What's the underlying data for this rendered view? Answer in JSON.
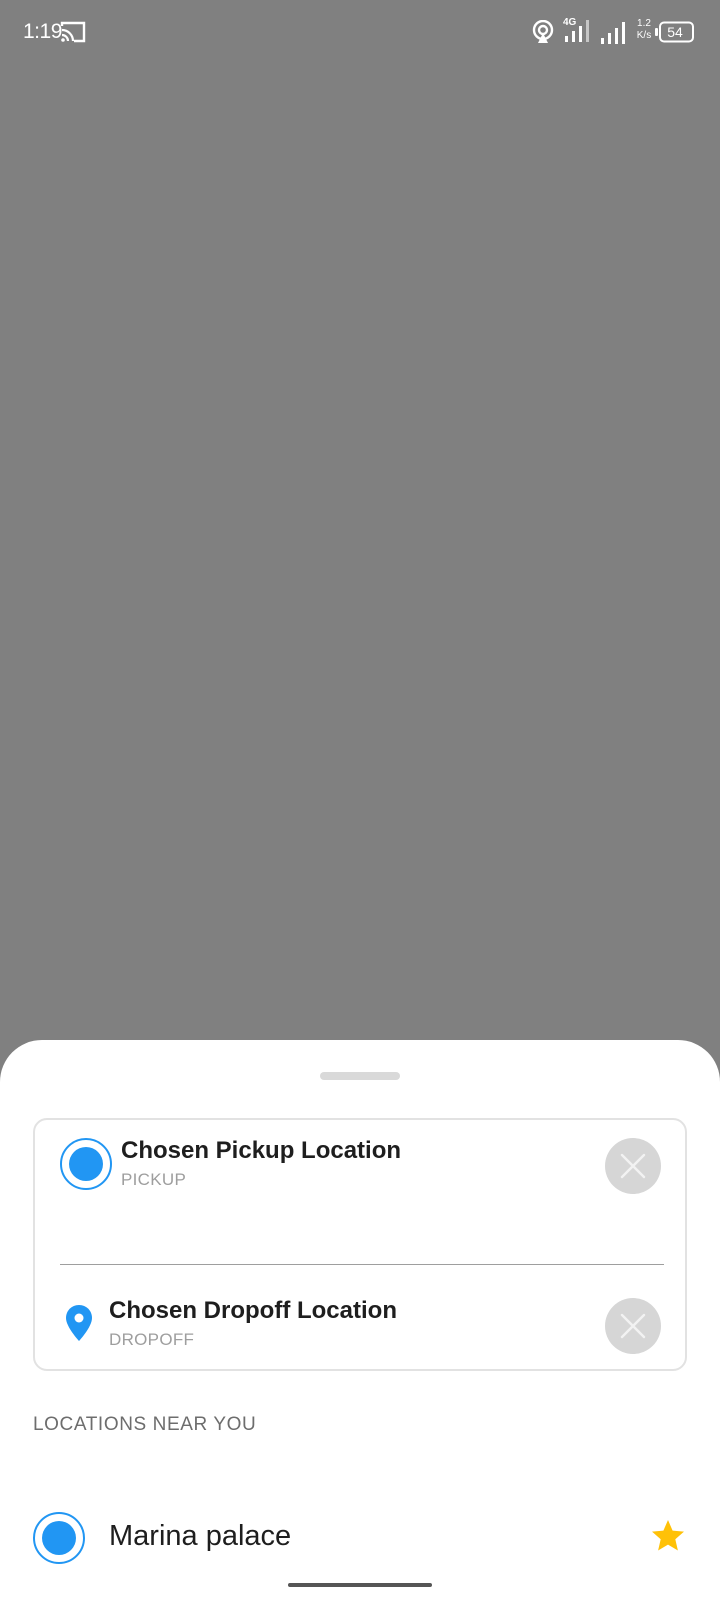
{
  "status_bar": {
    "time": "1:19",
    "network_type": "4G",
    "net_speed_value": "1.2",
    "net_speed_unit": "K/s",
    "battery": "54",
    "icons": [
      "cast-icon",
      "hotspot-icon",
      "signal-icon",
      "battery-icon"
    ]
  },
  "route": {
    "pickup": {
      "title": "Chosen Pickup Location",
      "subtitle": "PICKUP"
    },
    "dropoff": {
      "title": "Chosen Dropoff Location",
      "subtitle": "DROPOFF"
    }
  },
  "nearby": {
    "heading": "LOCATIONS NEAR YOU",
    "items": [
      {
        "name": "Marina palace",
        "favorite": true
      }
    ]
  },
  "colors": {
    "accent": "#2196f3",
    "star": "#ffc107",
    "backdrop": "#808080",
    "clear_button": "#d6d6d6"
  }
}
